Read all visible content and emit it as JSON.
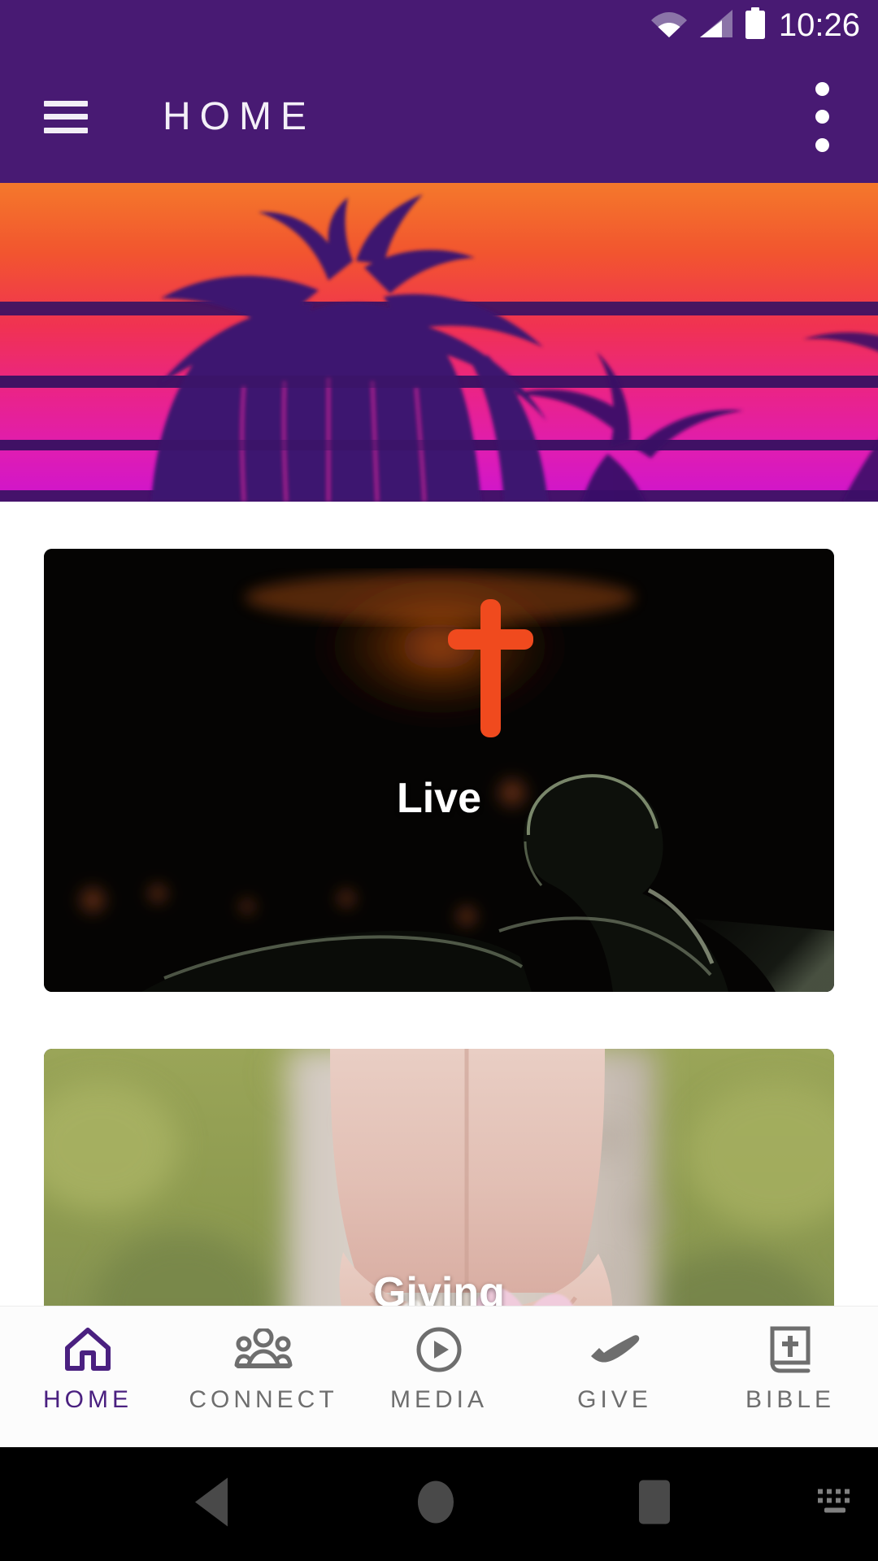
{
  "status_bar": {
    "time": "10:26",
    "icons": [
      "wifi-icon",
      "cellular-signal-icon",
      "battery-icon"
    ]
  },
  "app_bar": {
    "title": "HOME",
    "menu_icon": "hamburger-menu-icon",
    "overflow_icon": "more-vert-icon",
    "background_color": "#481A73"
  },
  "banner": {
    "alt": "synthwave palm tree sunset banner",
    "sky_top_color": "#F4722B",
    "sky_mid_color": "#F23A52",
    "sky_bottom_color": "#D217C6",
    "palm_color": "#3C1470",
    "band_color": "#3A1263"
  },
  "cards": [
    {
      "label": "Live",
      "name": "live-card",
      "image_alt": "worship service with illuminated cross",
      "accent_color": "#F04A1E",
      "background_color": "#050302"
    },
    {
      "label": "Giving",
      "name": "giving-card",
      "image_alt": "cupped hands holding daisy and pink flowers",
      "background_color": "#8E9A56"
    }
  ],
  "bottom_nav": {
    "active_color": "#4A2080",
    "inactive_color": "#6E6E6E",
    "items": [
      {
        "label": "HOME",
        "icon": "home-icon",
        "active": true
      },
      {
        "label": "CONNECT",
        "icon": "people-group-icon",
        "active": false
      },
      {
        "label": "MEDIA",
        "icon": "play-circle-icon",
        "active": false
      },
      {
        "label": "GIVE",
        "icon": "open-hand-icon",
        "active": false
      },
      {
        "label": "BIBLE",
        "icon": "bible-book-icon",
        "active": false
      }
    ]
  },
  "system_nav": {
    "back": "back-triangle-icon",
    "home": "home-circle-icon",
    "recents": "recents-square-icon",
    "keyboard": "keyboard-icon"
  }
}
